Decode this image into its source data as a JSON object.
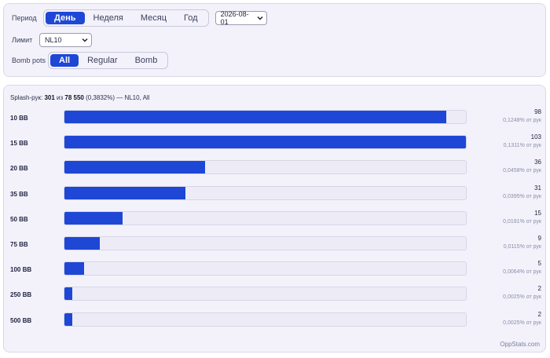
{
  "filters": {
    "period": {
      "label": "Период",
      "options": [
        "День",
        "Неделя",
        "Месяц",
        "Год"
      ],
      "active": 0
    },
    "date": "2026-08-01",
    "limit": {
      "label": "Лимит",
      "value": "NL10"
    },
    "bomb": {
      "label": "Bomb pots",
      "options": [
        "All",
        "Regular",
        "Bomb"
      ],
      "active": 0
    }
  },
  "summary": {
    "prefix": "Splash-рук: ",
    "count": "301",
    "of": " из ",
    "total": "78 550",
    "suffix": " (0,3832%) — NL10, All"
  },
  "brand": "OppStats.com",
  "chart_data": {
    "type": "bar",
    "orientation": "horizontal",
    "categories": [
      "10 BB",
      "15 BB",
      "20 BB",
      "35 BB",
      "50 BB",
      "75 BB",
      "100 BB",
      "250 BB",
      "500 BB"
    ],
    "values": [
      98,
      103,
      36,
      31,
      15,
      9,
      5,
      2,
      2
    ],
    "percent_labels": [
      "0,1248% от рук",
      "0,1311% от рук",
      "0,0458% от рук",
      "0,0395% от рук",
      "0,0191% от рук",
      "0,0115% от рук",
      "0,0064% от рук",
      "0,0025% от рук",
      "0,0025% от рук"
    ],
    "xlim": [
      0,
      103
    ],
    "colors": {
      "bar": "#1e47d6",
      "track": "#edecf6"
    }
  }
}
